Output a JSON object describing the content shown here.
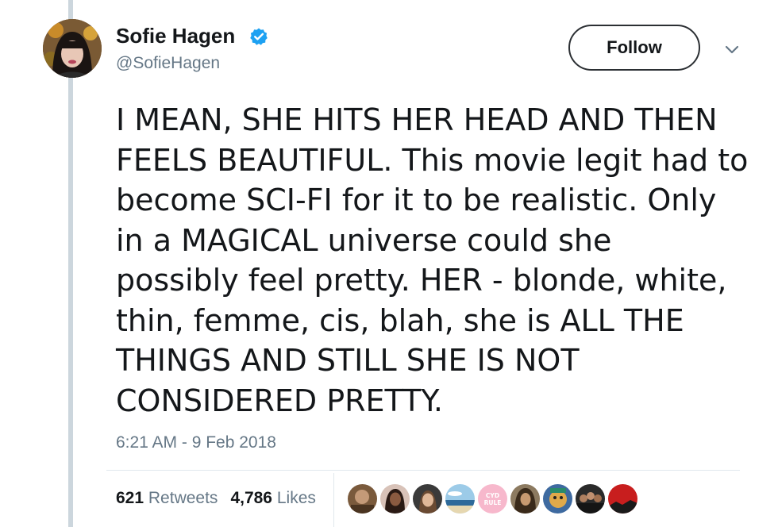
{
  "user": {
    "display_name": "Sofie Hagen",
    "handle": "@SofieHagen",
    "verified": true,
    "avatar_icon": "profile-photo"
  },
  "actions": {
    "follow_label": "Follow",
    "more_icon": "chevron-down-icon"
  },
  "tweet": {
    "text": "I MEAN, SHE HITS HER HEAD AND THEN\nFEELS BEAUTIFUL. This movie legit had to\nbecome SCI-FI for it to be realistic. Only\nin a MAGICAL universe could she\npossibly feel pretty. HER - blonde, white,\nthin, femme, cis, blah, she is ALL THE\nTHINGS AND STILL SHE IS NOT\nCONSIDERED PRETTY.",
    "timestamp": "6:21 AM - 9 Feb 2018"
  },
  "stats": {
    "retweets_count": "621",
    "retweets_label": "Retweets",
    "likes_count": "4,786",
    "likes_label": "Likes"
  },
  "likers_preview": [
    {
      "icon": "avatar-brown",
      "color": "#7a5a3c"
    },
    {
      "icon": "avatar-woman-dark",
      "color": "#3a2a20"
    },
    {
      "icon": "avatar-woman-light",
      "color": "#b48c6a"
    },
    {
      "icon": "avatar-landscape",
      "color": "#7fb3d8"
    },
    {
      "icon": "avatar-cyd-rule",
      "color": "#f7b8cc",
      "text": "CYD RULE"
    },
    {
      "icon": "avatar-dark-hair",
      "color": "#5a4632"
    },
    {
      "icon": "avatar-cartoon",
      "color": "#e0a94a"
    },
    {
      "icon": "avatar-group",
      "color": "#3c3c3c"
    },
    {
      "icon": "avatar-red",
      "color": "#c81e1e"
    }
  ],
  "colors": {
    "text_primary": "#14171a",
    "text_secondary": "#657786",
    "verified_blue": "#1da1f2",
    "thread_line": "#ccd6dd"
  }
}
